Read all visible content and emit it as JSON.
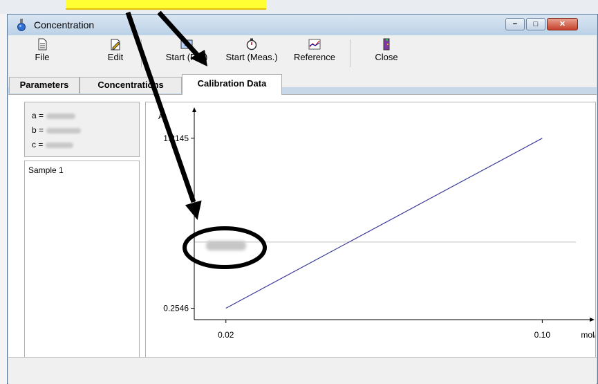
{
  "window": {
    "title": "Concentration",
    "controls": {
      "minimize": "−",
      "maximize": "□",
      "close": "✕"
    }
  },
  "toolbar": {
    "buttons": [
      {
        "label": "File",
        "icon": "file-icon"
      },
      {
        "label": "Edit",
        "icon": "edit-icon"
      },
      {
        "label": "Start (File)",
        "icon": "start-file-icon"
      },
      {
        "label": "Start (Meas.)",
        "icon": "stopwatch-icon"
      },
      {
        "label": "Reference",
        "icon": "reference-chart-icon"
      },
      {
        "label": "Close",
        "icon": "close-door-icon"
      }
    ]
  },
  "tabs": [
    {
      "label": "Parameters"
    },
    {
      "label": "Concentrations"
    },
    {
      "label": "Calibration Data",
      "active": true
    }
  ],
  "coefficients": {
    "a_label": "a =",
    "b_label": "b =",
    "c_label": "c ="
  },
  "samples": [
    "Sample 1"
  ],
  "chart_data": {
    "type": "line",
    "ylabel": "A",
    "xlabel": "mol/L",
    "x_ticks": [
      "0.02",
      "0.10"
    ],
    "y_ticks": [
      "1.2145",
      "0.2546"
    ],
    "series": [
      {
        "x": [
          0.02,
          0.1
        ],
        "y": [
          0.2546,
          1.2145
        ],
        "color": "#3b3b9a"
      }
    ],
    "xlim": [
      0.012,
      0.112
    ],
    "ylim": [
      0.19,
      1.37
    ],
    "reference_line_y": 0.628
  }
}
